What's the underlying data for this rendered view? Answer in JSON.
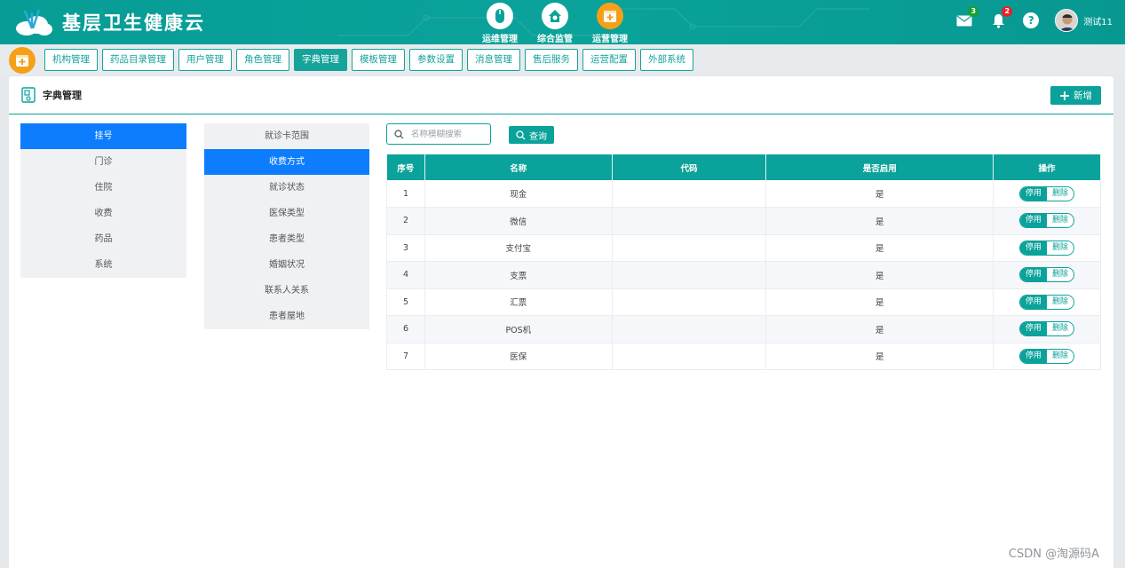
{
  "header": {
    "app_title": "基层卫生健康云",
    "nav": [
      {
        "label": "运维管理",
        "icon": "mouse-icon"
      },
      {
        "label": "综合监管",
        "icon": "house-gear-icon"
      },
      {
        "label": "运营管理",
        "icon": "calendar-cross-icon"
      }
    ],
    "mail_count": "3",
    "notify_count": "2",
    "help": "?",
    "user_name": "测试11"
  },
  "tabs": [
    "机构管理",
    "药品目录管理",
    "用户管理",
    "角色管理",
    "字典管理",
    "模板管理",
    "参数设置",
    "消息管理",
    "售后服务",
    "运营配置",
    "外部系统"
  ],
  "active_tab": "字典管理",
  "panel": {
    "title": "字典管理",
    "add_label": "新增"
  },
  "categories": [
    "挂号",
    "门诊",
    "住院",
    "收费",
    "药品",
    "系统"
  ],
  "active_category": "挂号",
  "subcategories": [
    "就诊卡范围",
    "收费方式",
    "就诊状态",
    "医保类型",
    "患者类型",
    "婚姻状况",
    "联系人关系",
    "患者屋地"
  ],
  "active_subcategory": "收费方式",
  "search": {
    "placeholder": "名称模糊搜索",
    "query_label": "查询"
  },
  "table": {
    "headers": [
      "序号",
      "名称",
      "代码",
      "是否启用",
      "操作"
    ],
    "rows": [
      {
        "no": "1",
        "name": "现金",
        "code": "",
        "enabled": "是"
      },
      {
        "no": "2",
        "name": "微信",
        "code": "",
        "enabled": "是"
      },
      {
        "no": "3",
        "name": "支付宝",
        "code": "",
        "enabled": "是"
      },
      {
        "no": "4",
        "name": "支票",
        "code": "",
        "enabled": "是"
      },
      {
        "no": "5",
        "name": "汇票",
        "code": "",
        "enabled": "是"
      },
      {
        "no": "6",
        "name": "POS机",
        "code": "",
        "enabled": "是"
      },
      {
        "no": "7",
        "name": "医保",
        "code": "",
        "enabled": "是"
      }
    ],
    "op_stop": "停用",
    "op_delete": "删除"
  },
  "watermark": "CSDN @淘源码A",
  "colors": {
    "primary": "#0aa29a",
    "active_menu": "#0d7dfd",
    "orange": "#f6a01a"
  }
}
